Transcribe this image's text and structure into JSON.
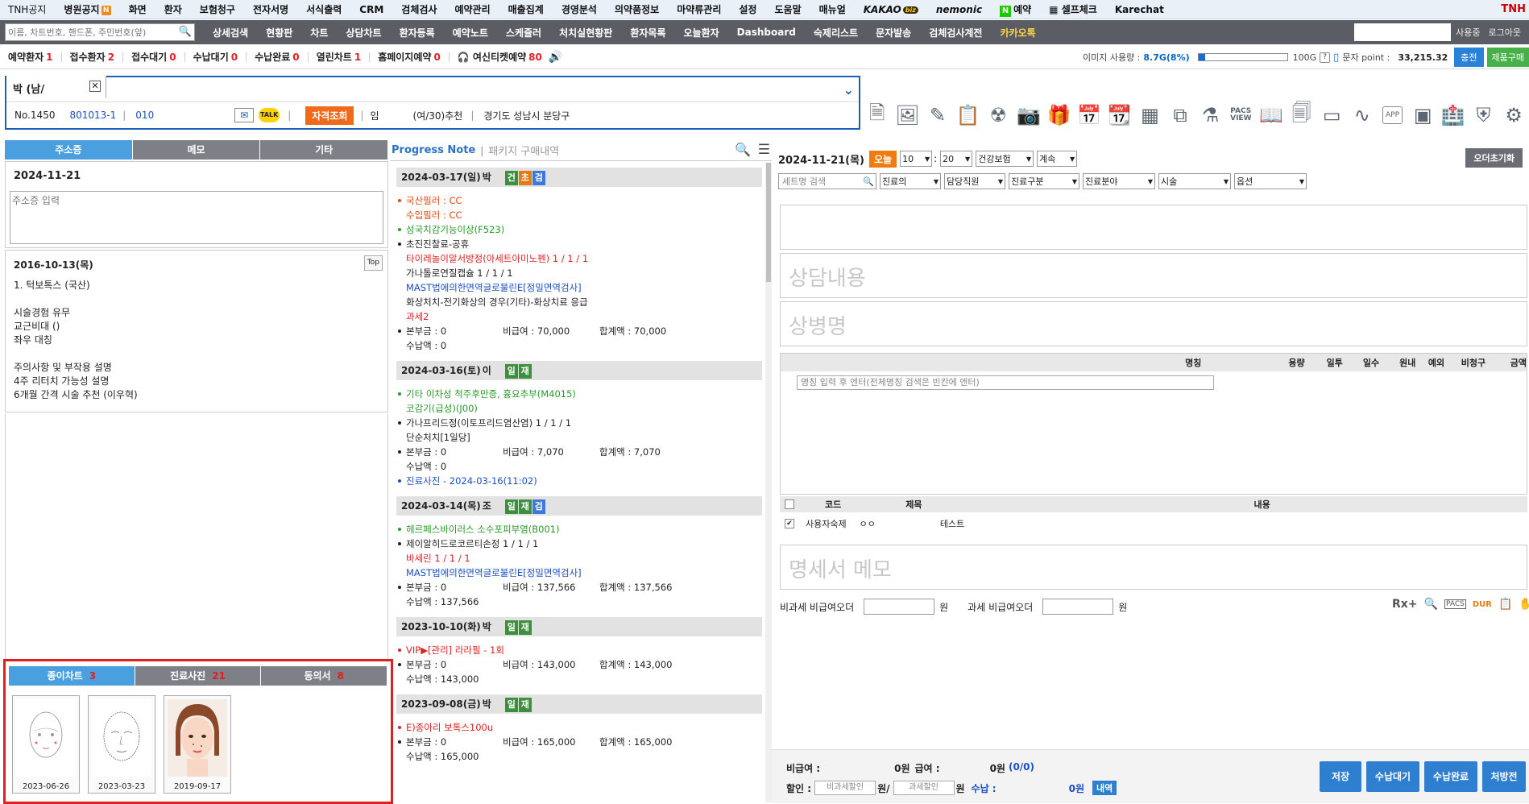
{
  "top_menu": [
    "TNH공지",
    "병원공지",
    "화면",
    "환자",
    "보험청구",
    "전자서명",
    "서식출력",
    "CRM",
    "검체검사",
    "예약관리",
    "매출집계",
    "경영분석",
    "의약품정보",
    "마약류관리",
    "설정",
    "도움말",
    "매뉴얼",
    "KAKAO",
    "nemonic",
    "예약",
    "셀프체크",
    "Karechat"
  ],
  "brand_right": "TNH",
  "search": {
    "placeholder": "이름, 차트번호, 핸드폰, 주민번호(앞)"
  },
  "nav": [
    "상세검색",
    "현황판",
    "차트",
    "상담차트",
    "환자등록",
    "예약노트",
    "스케쥴러",
    "처치실현황판",
    "환자목록",
    "오늘환자",
    "Dashboard",
    "숙제리스트",
    "문자발송",
    "검체검사계전",
    "카카오톡"
  ],
  "nav_right": [
    "사용중",
    "로그아웃"
  ],
  "status": [
    {
      "label": "예약환자",
      "n": "1"
    },
    {
      "label": "접수환자",
      "n": "2"
    },
    {
      "label": "접수대기",
      "n": "0"
    },
    {
      "label": "수납대기",
      "n": "0"
    },
    {
      "label": "수납완료",
      "n": "0"
    },
    {
      "label": "열린차트",
      "n": "1"
    },
    {
      "label": "홈페이지예약",
      "n": "0"
    },
    {
      "label": "여신티켓예약",
      "n": "80"
    }
  ],
  "usage": {
    "label": "이미지 사용량 :",
    "value": "8.7G(8%)",
    "fraction": 0.08,
    "total": "100G",
    "sms_label": "문자 point :",
    "sms": "33,215.32",
    "charge": "충전",
    "product": "제품구매"
  },
  "patient": {
    "tab": "박  (남/",
    "no": "No.1450",
    "chart": "801013-1",
    "phone": "010",
    "qual": "자격조회",
    "ins": "임",
    "ref": "(여/30)추천",
    "addr": "경기도 성남시 분당구"
  },
  "left_tabs": [
    "주소증",
    "메모",
    "기타"
  ],
  "complaint": {
    "date": "2024-11-21",
    "placeholder": "주소증 입력"
  },
  "history": {
    "date": "2016-10-13(목)",
    "top": "Top",
    "lines": [
      "1. 턱보톡스 (국산)",
      "",
      "시술경험 유무",
      "교근비대 ()",
      "좌우 대칭",
      "",
      "주의사항 및 부작용 설명",
      "4주 리터치 가능성 설명",
      "6개월 간격 시술 추천 (이우혁)"
    ]
  },
  "img_tabs": [
    {
      "label": "종이차트",
      "count": "3"
    },
    {
      "label": "진료사진",
      "count": "21"
    },
    {
      "label": "동의서",
      "count": "8"
    }
  ],
  "thumbs": [
    "2023-06-26",
    "2023-03-23",
    "2019-09-17"
  ],
  "pn": {
    "title": "Progress Note",
    "sub": "패키지 구매내역"
  },
  "visits": [
    {
      "date": "2024-03-17(일)",
      "who": "박",
      "badges": [
        "건",
        "초",
        "검"
      ],
      "lines": [
        [
          "o",
          "국산필러 :  CC",
          ""
        ],
        [
          "",
          "수입필러 :  CC",
          "c-o"
        ],
        [
          "g",
          "성국치감기능이상(F523)",
          ""
        ],
        [
          "b",
          "초진진찰료-공휴",
          ""
        ],
        [
          "",
          "타이레놀이알서방정(아세트아미노펜)  1 / 1 / 1",
          "c-r"
        ],
        [
          "",
          "가나톨로연질캡슐  1 / 1 / 1",
          ""
        ],
        [
          "",
          "MAST법에의한면역글로불린E[정밀면역검사]",
          "c-b"
        ],
        [
          "",
          "화상처치-전기화상의 경우(기타)-화상치료 응급",
          ""
        ],
        [
          "",
          "과세2",
          "c-r"
        ]
      ],
      "amt": [
        "본부금 : 0",
        "비급여 : 70,000",
        "합계액 : 70,000"
      ],
      "paid": "수납액 : 0"
    },
    {
      "date": "2024-03-16(토)",
      "who": "이",
      "badges": [
        "일",
        "재"
      ],
      "lines": [
        [
          "g",
          "기타 이차성 척주후만증, 흉요추부(M4015)",
          ""
        ],
        [
          "",
          "코감기(급성)(J00)",
          "c-g"
        ],
        [
          "b",
          "가나프리드정(이토프리드염산염)  1 / 1 / 1",
          ""
        ],
        [
          "",
          "단순처치[1일당]",
          ""
        ]
      ],
      "amt": [
        "본부금 : 0",
        "비급여 : 7,070",
        "합계액 : 7,070"
      ],
      "paid": "수납액 : 0",
      "extra": "진료사진 - 2024-03-16(11:02)"
    },
    {
      "date": "2024-03-14(목)",
      "who": "조",
      "badges": [
        "일",
        "재",
        "검"
      ],
      "lines": [
        [
          "g",
          "헤르페스바이러스 소수포피부염(B001)",
          ""
        ],
        [
          "b",
          "제이알히드로코르티손정  1 / 1 / 1",
          ""
        ],
        [
          "",
          "바세린  1 / 1 / 1",
          "c-r"
        ],
        [
          "",
          "MAST법에의한면역글로불린E[정밀면역검사]",
          "c-b"
        ]
      ],
      "amt": [
        "본부금 : 0",
        "비급여 : 137,566",
        "합계액 : 137,566"
      ],
      "paid": "수납액 : 137,566"
    },
    {
      "date": "2023-10-10(화)",
      "who": "박",
      "badges": [
        "일",
        "재"
      ],
      "lines": [
        [
          "r",
          "VIP▶[관리] 라라필  - 1회",
          ""
        ]
      ],
      "amt": [
        "본부금 : 0",
        "비급여 : 143,000",
        "합계액 : 143,000"
      ],
      "paid": "수납액 : 143,000"
    },
    {
      "date": "2023-09-08(금)",
      "who": "박",
      "badges": [
        "일",
        "재"
      ],
      "lines": [
        [
          "r",
          "E)종아리 보톡스100u",
          ""
        ]
      ],
      "amt": [
        "본부금 : 0",
        "비급여 : 165,000",
        "합계액 : 165,000"
      ],
      "paid": "수납액 : 165,000"
    }
  ],
  "right": {
    "date": "2024-11-21(목)",
    "today": "오늘",
    "h": "10",
    "m": "20",
    "ins": "건강보험",
    "cont": "계속",
    "order_reset": "오더초기화",
    "filters": [
      "세트명 검색",
      "진료의",
      "담당직원",
      "진료구분",
      "진료분야",
      "시술",
      "옵션"
    ],
    "consult": "상담내용",
    "disease": "상병명",
    "med_cols": [
      "명칭",
      "용량",
      "일투",
      "일수",
      "원내",
      "예외",
      "비청구",
      "금액"
    ],
    "med_input": "명칭 입력 후 엔터(전체명칭 검색은 빈칸에 엔터)",
    "memo_cols": [
      "코드",
      "제목",
      "내용"
    ],
    "memo_row": [
      "사용자숙제",
      "ㅇㅇ",
      "테스트"
    ],
    "bill_memo": "명세서 메모",
    "nonpay1": "비과세 비급여오더",
    "won": "원",
    "nonpay2": "과세 비급여오더",
    "tools": [
      "Rx+",
      "PACS",
      "DUR"
    ],
    "summary": {
      "nonpay": "비급여 :",
      "nonpay_v": "0원",
      "pay": "급여 :",
      "pay_v": "0원",
      "pay_cnt": "(0/0)",
      "disc": "할인 :",
      "disc1": "비과세할인",
      "disc2": "과세할인",
      "won": "원/",
      "won2": "원",
      "recv": "수납 :",
      "recv_v": "0원",
      "detail": "내역"
    },
    "actions": [
      "저장",
      "수납대기",
      "수납완료",
      "처방전"
    ]
  }
}
